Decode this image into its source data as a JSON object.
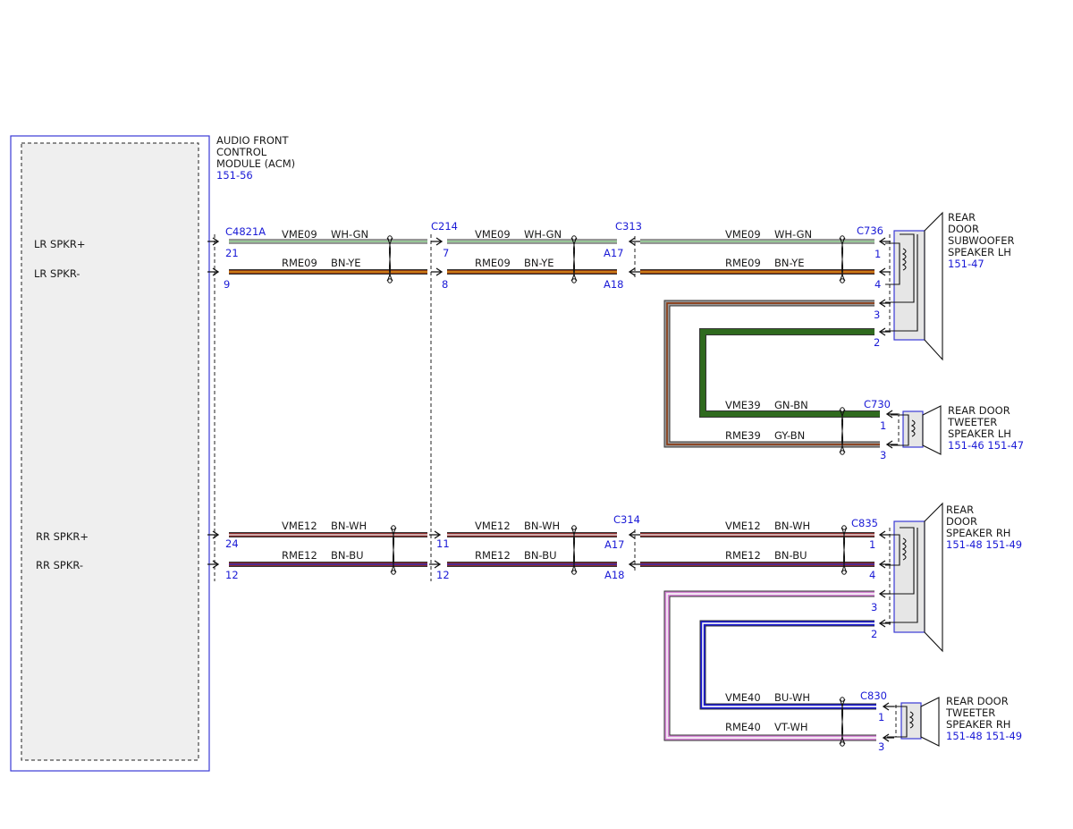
{
  "module": {
    "name_lines": [
      "AUDIO FRONT",
      "CONTROL",
      "MODULE (ACM)"
    ],
    "ref": "151-56",
    "pins": {
      "lr_plus": "LR SPKR+",
      "lr_minus": "LR SPKR-",
      "rr_plus": "RR SPKR+",
      "rr_minus": "RR SPKR-"
    }
  },
  "connectors": {
    "c4821a": "C4821A",
    "c214": "C214",
    "c313": "C313",
    "c314": "C314",
    "c736": "C736",
    "c730": "C730",
    "c835": "C835",
    "c830": "C830"
  },
  "pins": {
    "c4821a": [
      "21",
      "9",
      "24",
      "12"
    ],
    "c214": [
      "7",
      "8",
      "11",
      "12"
    ],
    "c313": [
      "A17",
      "A18"
    ],
    "c314": [
      "A17",
      "A18"
    ],
    "c736": [
      "1",
      "4",
      "3",
      "2"
    ],
    "c730": [
      "1",
      "3"
    ],
    "c835": [
      "1",
      "4",
      "3",
      "2"
    ],
    "c830": [
      "1",
      "3"
    ]
  },
  "circuits": {
    "vme09": {
      "name": "VME09",
      "color": "WH-GN"
    },
    "rme09": {
      "name": "RME09",
      "color": "BN-YE"
    },
    "vme39": {
      "name": "VME39",
      "color": "GN-BN"
    },
    "rme39": {
      "name": "RME39",
      "color": "GY-BN"
    },
    "vme12": {
      "name": "VME12",
      "color": "BN-WH"
    },
    "rme12": {
      "name": "RME12",
      "color": "BN-BU"
    },
    "vme40": {
      "name": "VME40",
      "color": "BU-WH"
    },
    "rme40": {
      "name": "RME40",
      "color": "VT-WH"
    }
  },
  "devices": {
    "sub_lh": {
      "lines": [
        "REAR",
        "DOOR",
        "SUBWOOFER",
        "SPEAKER LH"
      ],
      "ref": "151-47"
    },
    "tw_lh": {
      "lines": [
        "REAR DOOR",
        "TWEETER",
        "SPEAKER LH"
      ],
      "ref": "151-46  151-47"
    },
    "spk_rh": {
      "lines": [
        "REAR",
        "DOOR",
        "SPEAKER RH"
      ],
      "ref": "151-48  151-49"
    },
    "tw_rh": {
      "lines": [
        "REAR DOOR",
        "TWEETER",
        "SPEAKER RH"
      ],
      "ref": "151-48  151-49"
    }
  },
  "wire_colors": {
    "wh_gn": [
      "#f2f2f2",
      "#3a9a3a"
    ],
    "bn_ye": [
      "#8a3a14",
      "#f0a018"
    ],
    "gn_bn": [
      "#2f6a1e",
      "#2f6a1e"
    ],
    "gy_bn": [
      "#9a9a9a",
      "#8a3a14"
    ],
    "bn_wh": [
      "#8a2a2a",
      "#f4f4f4"
    ],
    "bn_bu": [
      "#8a2a2a",
      "#2a2acc"
    ],
    "bu_wh": [
      "#1a1ad6",
      "#f4f4f4"
    ],
    "vt_wh": [
      "#d98ad9",
      "#f4f4f4"
    ]
  }
}
